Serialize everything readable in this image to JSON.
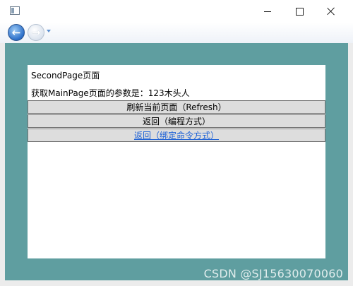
{
  "window": {
    "icons": {
      "app": "app-window-icon",
      "minimize": "minimize-icon",
      "maximize": "maximize-icon",
      "close": "close-icon"
    }
  },
  "nav": {
    "back_icon": "arrow-left-icon",
    "forward_icon": "arrow-right-icon",
    "history_icon": "chevron-down-icon",
    "back_glyph": "←",
    "forward_glyph": "→"
  },
  "page": {
    "title": "SecondPage页面",
    "param_text": "获取MainPage页面的参数是：123木头人",
    "buttons": {
      "refresh": "刷新当前页面（Refresh）",
      "back_code": "返回（编程方式）",
      "back_command": "返回（绑定命令方式）"
    }
  },
  "watermark": "CSDN @SJ15630070060",
  "colors": {
    "content_background": "#5f9ea0",
    "page_background": "#ffffff",
    "button_background": "#dddddd",
    "link_text": "#1a5fd6"
  }
}
